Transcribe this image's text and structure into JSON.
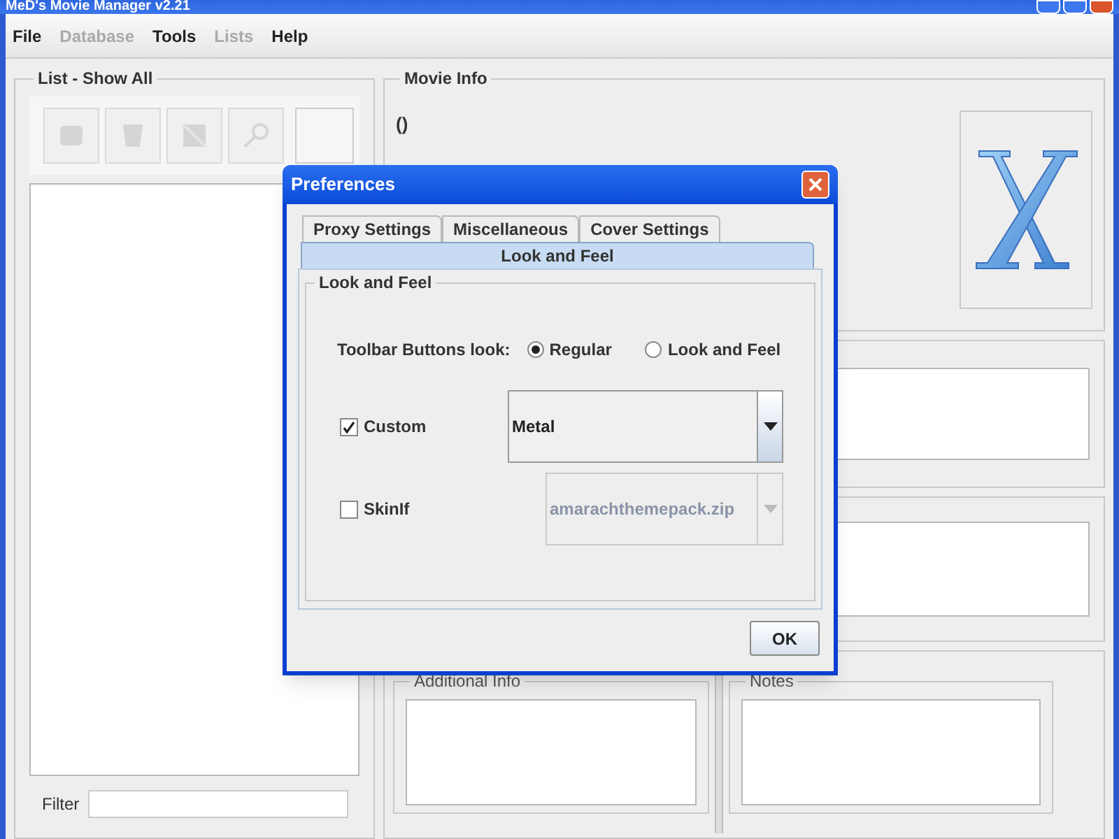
{
  "window": {
    "title": "MeD's Movie Manager v2.21"
  },
  "menu": [
    {
      "label": "File",
      "disabled": false
    },
    {
      "label": "Database",
      "disabled": true
    },
    {
      "label": "Tools",
      "disabled": false
    },
    {
      "label": "Lists",
      "disabled": true
    },
    {
      "label": "Help",
      "disabled": false
    }
  ],
  "list_panel": {
    "title": "List - Show All",
    "toolbar": [
      {
        "kind": "add",
        "disabled": true
      },
      {
        "kind": "delete",
        "disabled": true
      },
      {
        "kind": "edit",
        "disabled": true
      },
      {
        "kind": "search",
        "disabled": true
      }
    ],
    "filter": {
      "label": "Filter"
    }
  },
  "movie_info": {
    "title": "Movie Info",
    "heading": "()"
  },
  "additional_info": {
    "title": "Additional Info"
  },
  "notes": {
    "title": "Notes"
  },
  "dialog": {
    "title": "Preferences",
    "tabs": [
      {
        "label": "Proxy Settings",
        "selected": false
      },
      {
        "label": "Miscellaneous",
        "selected": false
      },
      {
        "label": "Cover Settings",
        "selected": false
      },
      {
        "label": "Look and Feel",
        "selected": true
      }
    ],
    "group_title": "Look and Feel",
    "toolbar_look": {
      "label": "Toolbar Buttons look:",
      "options": [
        {
          "label": "Regular",
          "selected": true
        },
        {
          "label": "Look and Feel",
          "selected": false
        }
      ]
    },
    "options": [
      {
        "label": "Custom",
        "checked": true,
        "combo": {
          "value": "Metal",
          "disabled": false
        }
      },
      {
        "label": "SkinIf",
        "checked": false,
        "combo": {
          "value": "amarachthemepack.zip",
          "disabled": true
        }
      }
    ],
    "ok": "OK"
  }
}
